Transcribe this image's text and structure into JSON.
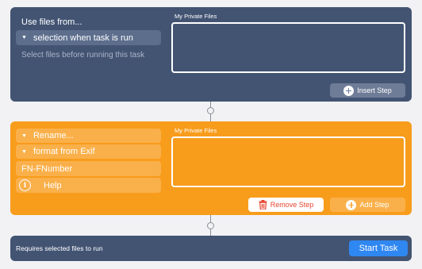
{
  "step1": {
    "title": "Use files from...",
    "source_option": "selection when task is run",
    "hint": "Select files before running this task",
    "destination_label": "My Private Files",
    "insert_button": "Insert Step"
  },
  "step2": {
    "action": "Rename...",
    "format_option": "format from Exif",
    "format_value": "FN-FNumber",
    "help_label": "Help",
    "destination_label": "My Private Files",
    "remove_button": "Remove Step",
    "add_button": "Add Step"
  },
  "footer": {
    "status": "Requires selected files to run",
    "start_button": "Start Task"
  },
  "colors": {
    "step1_bg": "#435473",
    "step2_bg": "#f89c1c",
    "start_button": "#2f87f2",
    "remove_text": "#e8442f"
  },
  "icons": {
    "insert": "plus-circle-icon",
    "remove": "trash-icon",
    "add": "plus-circle-icon",
    "help": "info-icon",
    "expand": "triangle-down-icon"
  }
}
